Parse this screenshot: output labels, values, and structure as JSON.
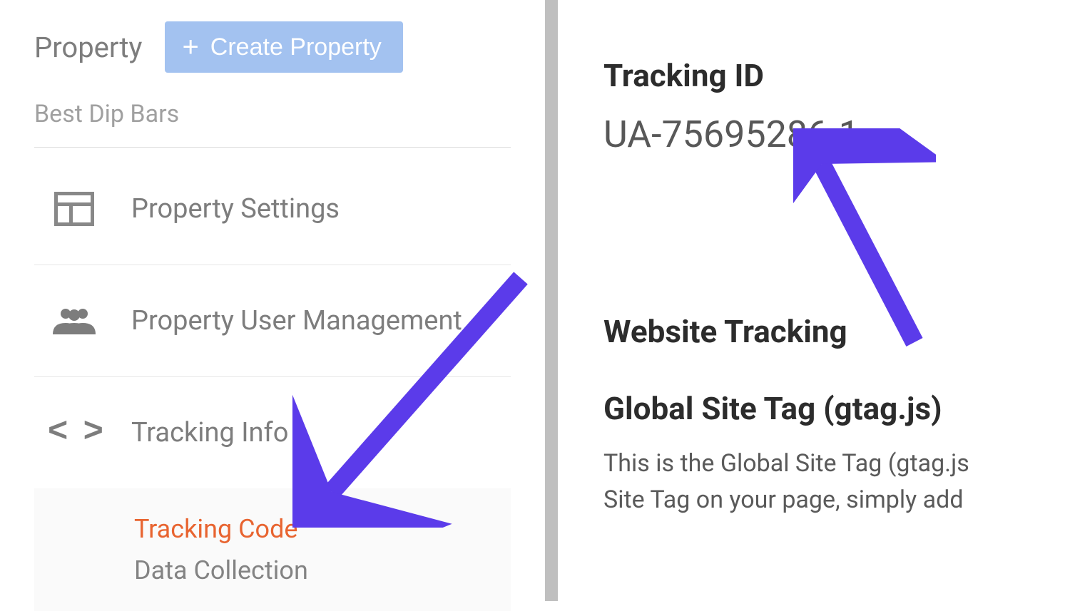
{
  "sidebar": {
    "section_label": "Property",
    "create_button": "Create Property",
    "property_name": "Best Dip Bars",
    "items": [
      {
        "label": "Property Settings",
        "icon": "settings-box"
      },
      {
        "label": "Property User Management",
        "icon": "people"
      },
      {
        "label": "Tracking Info",
        "icon": "code-brackets"
      }
    ],
    "sub_items": [
      {
        "label": "Tracking Code",
        "active": true
      },
      {
        "label": "Data Collection",
        "active": false
      }
    ]
  },
  "main": {
    "tracking_id_label": "Tracking ID",
    "tracking_id_value": "UA-75695286-1",
    "website_tracking_heading": "Website Tracking",
    "global_tag_heading": "Global Site Tag (gtag.js)",
    "description_line1": "This is the Global Site Tag (gtag.js",
    "description_line2": "Site Tag on your page, simply add"
  },
  "annotations": {
    "arrow_color": "#5b3bea"
  }
}
